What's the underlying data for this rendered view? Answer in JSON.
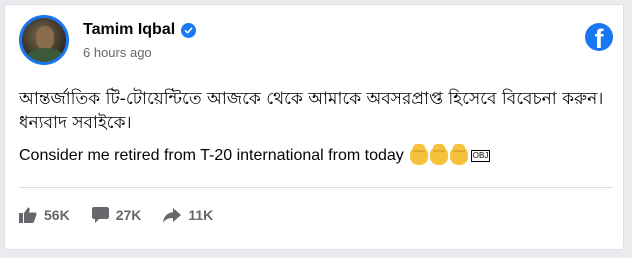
{
  "post": {
    "author": "Tamim Iqbal",
    "time": "6 hours ago",
    "text_bangla": "আন্তর্জাতিক টি-টোয়েন্টিতে আজকে থেকে আমাকে অবসরপ্রাপ্ত হিসেবে বিবেচনা করুন। ধন্যবাদ সবাইকে।",
    "text_english": "Consider me retired from T-20 international from today",
    "emoji_suffix": "OBJ",
    "icons": {
      "avatar": "profile-photo",
      "verified": "verified-badge-icon",
      "brand": "facebook-logo-icon",
      "hands": "waving-hand-emoji"
    }
  },
  "stats": {
    "likes": "56K",
    "comments": "27K",
    "shares": "11K"
  },
  "colors": {
    "accent": "#1877f2",
    "secondary_text": "#65676b",
    "primary_text": "#050505"
  }
}
